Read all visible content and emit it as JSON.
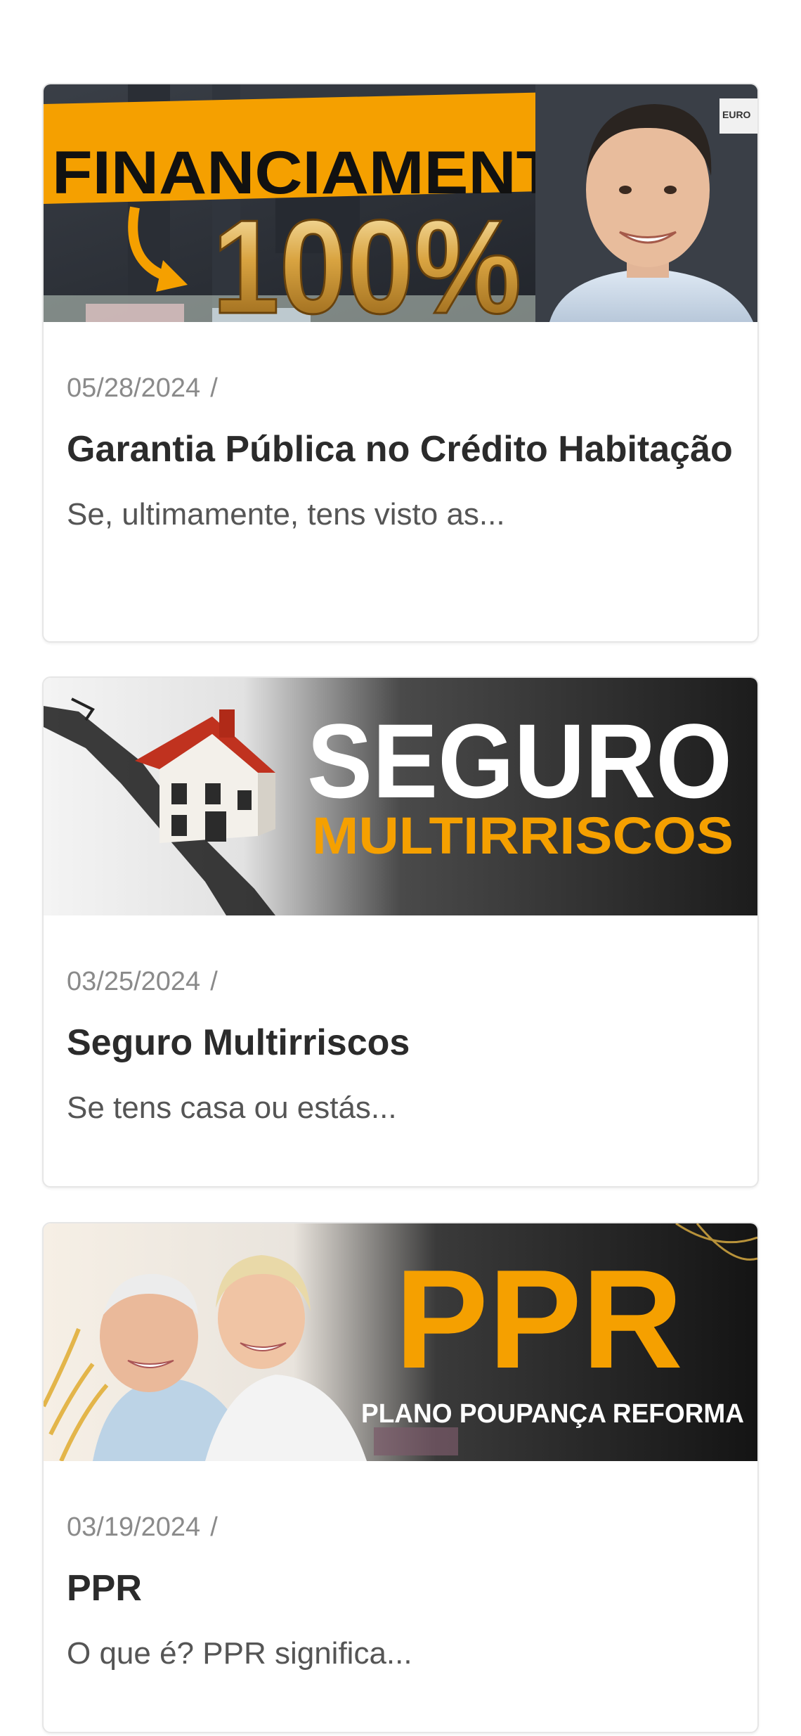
{
  "posts": [
    {
      "date": "05/28/2024",
      "separator": "/",
      "title": "Garantia Pública no Crédito Habitação",
      "excerpt": "Se, ultimamente, tens visto as...",
      "thumbnail": {
        "text_main": "FINANCIAMENTO",
        "text_big": "100%",
        "corner_text": "EURO",
        "accent": "#f5a000"
      }
    },
    {
      "date": "03/25/2024",
      "separator": "/",
      "title": "Seguro Multirriscos",
      "excerpt": "Se tens casa ou estás...",
      "thumbnail": {
        "text_main": "SEGURO",
        "text_sub": "MULTIRRISCOS",
        "accent": "#f5a000"
      }
    },
    {
      "date": "03/19/2024",
      "separator": "/",
      "title": "PPR",
      "excerpt": "O que é? PPR significa...",
      "thumbnail": {
        "text_main": "PPR",
        "text_sub": "PLANO POUPANÇA REFORMA",
        "accent": "#f5a000"
      }
    }
  ]
}
